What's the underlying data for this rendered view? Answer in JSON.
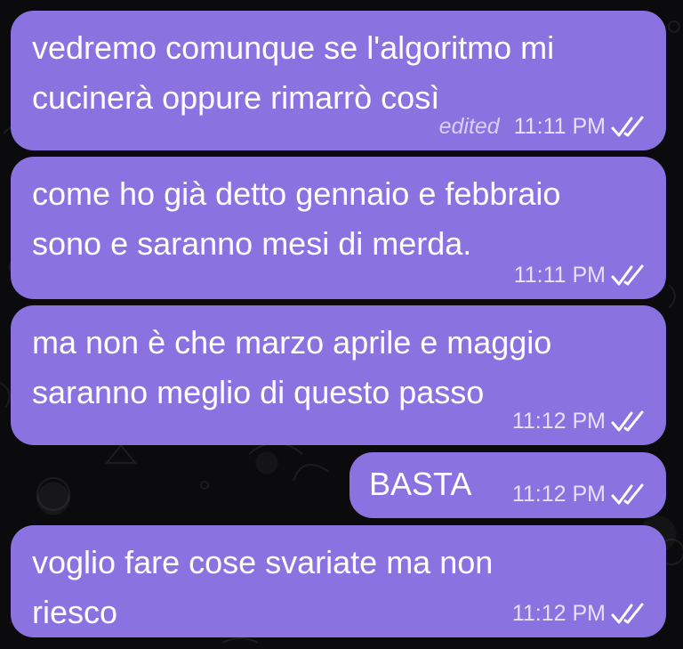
{
  "messages": [
    {
      "text": "vedremo comunque se l'algoritmo mi\ncucinerà oppure rimarrò così",
      "edited_label": "edited",
      "time": "11:11 PM",
      "status_icon": "double-check-icon"
    },
    {
      "text": "come ho già detto gennaio e febbraio\nsono e saranno mesi di merda.",
      "time": "11:11 PM",
      "status_icon": "double-check-icon"
    },
    {
      "text": "ma non è che marzo aprile e maggio\nsaranno meglio di questo passo",
      "time": "11:12 PM",
      "status_icon": "double-check-icon"
    },
    {
      "text": "BASTA",
      "time": "11:12 PM",
      "status_icon": "double-check-icon"
    },
    {
      "text": "voglio fare cose svariate ma non\nriesco",
      "time": "11:12 PM",
      "status_icon": "double-check-icon"
    }
  ],
  "colors": {
    "bubble": "#8a72e0",
    "background": "#0b0b0d",
    "text": "#ffffff"
  }
}
